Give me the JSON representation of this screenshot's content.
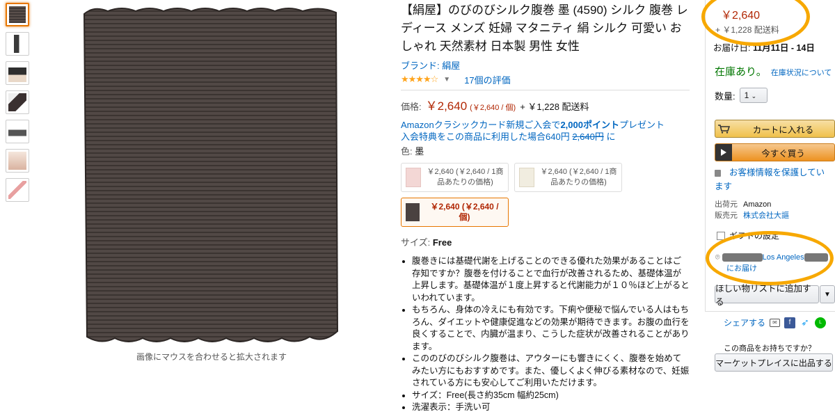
{
  "gallery": {
    "thumbnails": [
      "thumb-1",
      "thumb-2",
      "thumb-3",
      "thumb-4",
      "thumb-5",
      "thumb-6",
      "thumb-7"
    ],
    "hover_hint": "画像にマウスを合わせると拡大されます"
  },
  "product": {
    "title": "【絹屋】のびのびシルク腹巻 墨 (4590) シルク 腹巻 レディース メンズ 妊婦 マタニティ 絹 シルク 可愛い おしゃれ 天然素材 日本製 男性 女性",
    "brand": "ブランド: 絹屋",
    "stars": "★★★★☆",
    "reviews": "17個の評価",
    "price_label": "価格:",
    "price": "￥2,640",
    "price_unit": "(￥2,640 / 個)",
    "shipping": "+ ￥1,228 配送料",
    "promo_line1_pre": "Amazonクラシックカード新規ご入会で",
    "promo_points": "2,000ポイント",
    "promo_line1_post": "プレゼント",
    "promo_line2_pre": "入会特典をこの商品に利用した場合640円",
    "promo_strike": "2,640円",
    "promo_line2_post": "に",
    "color_label": "色:",
    "color_value": "墨",
    "swatches": [
      {
        "text": "￥2,640 (￥2,640 / 1商品あたりの価格)",
        "color": "#f3d7d5"
      },
      {
        "text": "￥2,640 (￥2,640 / 1商品あたりの価格)",
        "color": "#f1ede0"
      },
      {
        "text": "￥2,640 (￥2,640 / 個)",
        "color": "#4a4240"
      }
    ],
    "size_label": "サイズ:",
    "size_value": "Free",
    "bullets": [
      "腹巻きには基礎代謝を上げることのできる優れた効果があることはご存知ですか？腹巻を付けることで血行が改善されるため、基礎体温が上昇します。基礎体温が１度上昇すると代謝能力が１０％ほど上がるといわれています。",
      "もちろん、身体の冷えにも有効です。下痢や便秘で悩んでいる人はもちろん、ダイエットや健康促進などの効果が期待できます。お腹の血行を良くすることで、内臓が温まり、こうした症状が改善されることがあります。",
      "こののびのびシルク腹巻は、アウターにも響きにくく、腹巻を始めてみたい方にもおすすめです。また、優しくよく伸びる素材なので、妊娠されている方にも安心してご利用いただけます。",
      "サイズ：Free(長さ約35cm 幅約25cm)",
      "洗濯表示：手洗い可"
    ]
  },
  "buybox": {
    "price": "￥2,640",
    "shipping": "+ ￥1,228 配送料",
    "delivery_prefix": "お届け日:",
    "delivery_dates": "11月11日 - 14日",
    "stock": "在庫あり。",
    "stock_link": "在庫状況について",
    "qty_label": "数量:",
    "qty_value": "1",
    "cart_button": "カートに入れる",
    "buy_button": "今すぐ買う",
    "secure_text": "お客様情報を保護しています",
    "shipper_label": "出荷元",
    "shipper_value": "Amazon",
    "seller_label": "販売元",
    "seller_value": "株式会社大謳",
    "gift_label": "ギフトの設定",
    "deliver_city": "Los Angeles",
    "deliver_suffix": "にお届け",
    "wishlist_button": "ほしい物リストに追加する",
    "share_label": "シェアする",
    "own_text": "この商品をお持ちですか？",
    "sell_button": "マーケットプレイスに出品する"
  },
  "colors": {
    "price": "#b12704",
    "link": "#0066c0",
    "stock": "#007600",
    "annotation": "#f7a800",
    "product_fabric": "#4b4442"
  }
}
